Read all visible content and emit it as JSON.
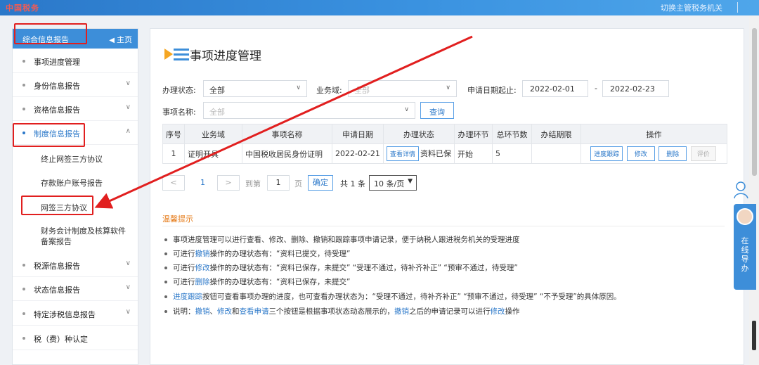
{
  "header": {
    "logo": "中国税务",
    "right_text": "切换主管税务机关"
  },
  "sidebar": {
    "title": "综合信息报告",
    "home_label": "主页",
    "items": [
      {
        "label": "事项进度管理"
      },
      {
        "label": "身份信息报告"
      },
      {
        "label": "资格信息报告"
      },
      {
        "label": "制度信息报告"
      },
      {
        "label": "终止网签三方协议"
      },
      {
        "label": "存款账户账号报告"
      },
      {
        "label": "网签三方协议"
      },
      {
        "label": "财务会计制度及核算软件备案报告"
      },
      {
        "label": "税源信息报告"
      },
      {
        "label": "状态信息报告"
      },
      {
        "label": "特定涉税信息报告"
      },
      {
        "label": "税（费）种认定"
      }
    ]
  },
  "main": {
    "title": "事项进度管理",
    "filters": {
      "status_label": "办理状态:",
      "status_value": "全部",
      "domain_label": "业务域:",
      "domain_placeholder": "全部",
      "date_label": "申请日期起止:",
      "date_from": "2022-02-01",
      "date_sep": "-",
      "date_to": "2022-02-23",
      "name_label": "事项名称:",
      "name_placeholder": "全部",
      "query_button": "查询"
    },
    "table": {
      "headers": [
        "序号",
        "业务域",
        "事项名称",
        "申请日期",
        "办理状态",
        "办理环节",
        "总环节数",
        "办结期限",
        "操作"
      ],
      "rows": [
        {
          "index": "1",
          "domain": "证明开具",
          "name": "中国税收居民身份证明",
          "date": "2022-02-21",
          "detail_button": "查看详情",
          "status": "资料已保",
          "step": "开始",
          "total_steps": "5",
          "deadline": "",
          "actions": [
            "进度跟踪",
            "修改",
            "删除",
            "评价"
          ]
        }
      ]
    },
    "pager": {
      "prev": "<",
      "current": "1",
      "next": ">",
      "goto_label": "到第",
      "goto_value": "1",
      "page_unit": "页",
      "confirm": "确定",
      "total": "共 1 条",
      "page_size": "10 条/页"
    },
    "tips": {
      "title": "温馨提示",
      "line1": "事项进度管理可以进行查看、修改、删除、撤销和跟踪事项申请记录，便于纳税人跟进税务机关的受理进度",
      "line2_pre": "可进行",
      "line2_link": "撤销",
      "line2_post": "操作的办理状态有：“资料已提交，待受理”",
      "line3_pre": "可进行",
      "line3_link": "修改",
      "line3_post": "操作的办理状态有：“资料已保存，未提交”  “受理不通过，待补齐补正”  “预审不通过，待受理”",
      "line4_pre": "可进行",
      "line4_link": "删除",
      "line4_post": "操作的办理状态有：“资料已保存，未提交”",
      "line5_link": "进度跟踪",
      "line5_post": "按钮可查看事项办理的进度，也可查看办理状态为：“受理不通过，待补齐补正”  “预审不通过，待受理”  “不予受理”的具体原因。",
      "line6_pre": "说明：",
      "line6_link1": "撤销",
      "line6_sep1": "、",
      "line6_link2": "修改",
      "line6_mid": "和",
      "line6_link3": "查看申请",
      "line6_mid2": "三个按钮是根据事项状态动态展示的，",
      "line6_link4": "撤销",
      "line6_mid3": "之后的申请记录可以进行",
      "line6_link5": "修改",
      "line6_end": "操作"
    }
  },
  "float_tool": {
    "guide_text": "在线导办"
  },
  "colors": {
    "brand_blue": "#3d8ed9",
    "link_blue": "#2b78c9",
    "highlight_red": "#e11f1f",
    "tips_orange": "#e57a17"
  }
}
